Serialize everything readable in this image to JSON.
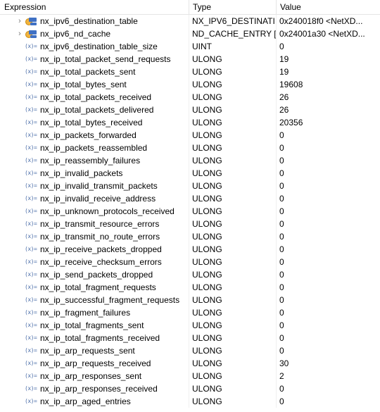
{
  "header": {
    "expression": "Expression",
    "type": "Type",
    "value": "Value"
  },
  "rows": [
    {
      "expr": "nx_ipv6_destination_table",
      "type": "NX_IPV6_DESTINATI...",
      "value": "0x240018f0 <NetXD...",
      "kind": "struct"
    },
    {
      "expr": "nx_ipv6_nd_cache",
      "type": "ND_CACHE_ENTRY [...",
      "value": "0x24001a30 <NetXD...",
      "kind": "struct"
    },
    {
      "expr": "nx_ipv6_destination_table_size",
      "type": "UINT",
      "value": "0",
      "kind": "var"
    },
    {
      "expr": "nx_ip_total_packet_send_requests",
      "type": "ULONG",
      "value": "19",
      "kind": "var"
    },
    {
      "expr": "nx_ip_total_packets_sent",
      "type": "ULONG",
      "value": "19",
      "kind": "var"
    },
    {
      "expr": "nx_ip_total_bytes_sent",
      "type": "ULONG",
      "value": "19608",
      "kind": "var"
    },
    {
      "expr": "nx_ip_total_packets_received",
      "type": "ULONG",
      "value": "26",
      "kind": "var"
    },
    {
      "expr": "nx_ip_total_packets_delivered",
      "type": "ULONG",
      "value": "26",
      "kind": "var"
    },
    {
      "expr": "nx_ip_total_bytes_received",
      "type": "ULONG",
      "value": "20356",
      "kind": "var"
    },
    {
      "expr": "nx_ip_packets_forwarded",
      "type": "ULONG",
      "value": "0",
      "kind": "var"
    },
    {
      "expr": "nx_ip_packets_reassembled",
      "type": "ULONG",
      "value": "0",
      "kind": "var"
    },
    {
      "expr": "nx_ip_reassembly_failures",
      "type": "ULONG",
      "value": "0",
      "kind": "var"
    },
    {
      "expr": "nx_ip_invalid_packets",
      "type": "ULONG",
      "value": "0",
      "kind": "var"
    },
    {
      "expr": "nx_ip_invalid_transmit_packets",
      "type": "ULONG",
      "value": "0",
      "kind": "var"
    },
    {
      "expr": "nx_ip_invalid_receive_address",
      "type": "ULONG",
      "value": "0",
      "kind": "var"
    },
    {
      "expr": "nx_ip_unknown_protocols_received",
      "type": "ULONG",
      "value": "0",
      "kind": "var"
    },
    {
      "expr": "nx_ip_transmit_resource_errors",
      "type": "ULONG",
      "value": "0",
      "kind": "var"
    },
    {
      "expr": "nx_ip_transmit_no_route_errors",
      "type": "ULONG",
      "value": "0",
      "kind": "var"
    },
    {
      "expr": "nx_ip_receive_packets_dropped",
      "type": "ULONG",
      "value": "0",
      "kind": "var"
    },
    {
      "expr": "nx_ip_receive_checksum_errors",
      "type": "ULONG",
      "value": "0",
      "kind": "var"
    },
    {
      "expr": "nx_ip_send_packets_dropped",
      "type": "ULONG",
      "value": "0",
      "kind": "var"
    },
    {
      "expr": "nx_ip_total_fragment_requests",
      "type": "ULONG",
      "value": "0",
      "kind": "var"
    },
    {
      "expr": "nx_ip_successful_fragment_requests",
      "type": "ULONG",
      "value": "0",
      "kind": "var"
    },
    {
      "expr": "nx_ip_fragment_failures",
      "type": "ULONG",
      "value": "0",
      "kind": "var"
    },
    {
      "expr": "nx_ip_total_fragments_sent",
      "type": "ULONG",
      "value": "0",
      "kind": "var"
    },
    {
      "expr": "nx_ip_total_fragments_received",
      "type": "ULONG",
      "value": "0",
      "kind": "var"
    },
    {
      "expr": "nx_ip_arp_requests_sent",
      "type": "ULONG",
      "value": "0",
      "kind": "var"
    },
    {
      "expr": "nx_ip_arp_requests_received",
      "type": "ULONG",
      "value": "30",
      "kind": "var"
    },
    {
      "expr": "nx_ip_arp_responses_sent",
      "type": "ULONG",
      "value": "2",
      "kind": "var"
    },
    {
      "expr": "nx_ip_arp_responses_received",
      "type": "ULONG",
      "value": "0",
      "kind": "var"
    },
    {
      "expr": "nx_ip_arp_aged_entries",
      "type": "ULONG",
      "value": "0",
      "kind": "var"
    }
  ],
  "icons": {
    "struct": "struct-variable-icon",
    "var": "variable-icon",
    "expand": "chevron-right-icon"
  },
  "var_icon_glyph": "(x)=",
  "expand_glyph": "›"
}
